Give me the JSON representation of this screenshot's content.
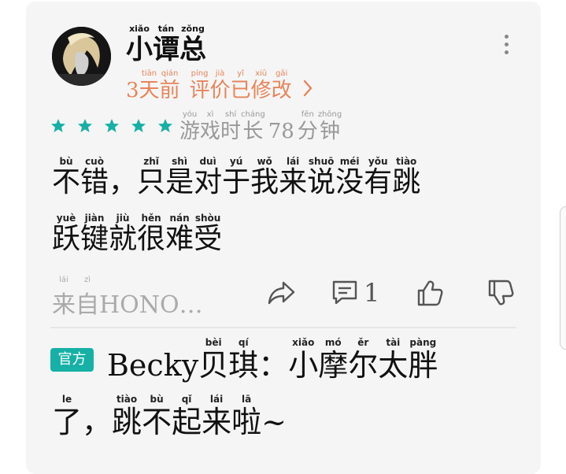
{
  "review": {
    "user_name": [
      [
        "xiǎo",
        "小"
      ],
      [
        "tán",
        "谭"
      ],
      [
        "zǒng",
        "总"
      ]
    ],
    "meta": [
      [
        "3",
        ""
      ],
      [
        "tiān",
        "天"
      ],
      [
        "qián",
        "前"
      ],
      [
        "",
        ""
      ],
      [
        "píng",
        "评"
      ],
      [
        "jià",
        "价"
      ],
      [
        "yǐ",
        "已"
      ],
      [
        "xiū",
        "修"
      ],
      [
        "gǎi",
        "改"
      ]
    ],
    "meta_text": "3天前 评价已修改",
    "rating_stars": 5,
    "playtime_label": [
      [
        "yóu",
        "游"
      ],
      [
        "xì",
        "戏"
      ],
      [
        "shí",
        "时"
      ],
      [
        "cháng",
        "长"
      ]
    ],
    "playtime_value": "78",
    "playtime_unit": [
      [
        "fēn",
        "分"
      ],
      [
        "zhōng",
        "钟"
      ]
    ],
    "body_line1": [
      [
        "bù",
        "不"
      ],
      [
        "cuò",
        "错"
      ],
      [
        "",
        "，"
      ],
      [
        "zhǐ",
        "只"
      ],
      [
        "shì",
        "是"
      ],
      [
        "duì",
        "对"
      ],
      [
        "yú",
        "于"
      ],
      [
        "wǒ",
        "我"
      ],
      [
        "lái",
        "来"
      ],
      [
        "shuō",
        "说"
      ],
      [
        "méi",
        "没"
      ],
      [
        "yǒu",
        "有"
      ],
      [
        "tiào",
        "跳"
      ]
    ],
    "body_line2": [
      [
        "yuè",
        "跃"
      ],
      [
        "jiàn",
        "键"
      ],
      [
        "jiù",
        "就"
      ],
      [
        "hěn",
        "很"
      ],
      [
        "nán",
        "难"
      ],
      [
        "shòu",
        "受"
      ]
    ],
    "source_prefix": [
      [
        "lái",
        "来"
      ],
      [
        "zì",
        "自"
      ]
    ],
    "source_device": "HONO…",
    "comment_count": "1"
  },
  "reply": {
    "badge": "官方",
    "author": "Becky",
    "author_cn": [
      [
        "bèi",
        "贝"
      ],
      [
        "qí",
        "琪"
      ],
      [
        "",
        "："
      ]
    ],
    "line1": [
      [
        "xiǎo",
        "小"
      ],
      [
        "mó",
        "摩"
      ],
      [
        "ěr",
        "尔"
      ],
      [
        "tài",
        "太"
      ],
      [
        "pàng",
        "胖"
      ]
    ],
    "line2": [
      [
        "le",
        "了"
      ],
      [
        "",
        "，"
      ],
      [
        "tiào",
        "跳"
      ],
      [
        "bù",
        "不"
      ],
      [
        "qǐ",
        "起"
      ],
      [
        "lái",
        "来"
      ],
      [
        "lā",
        "啦"
      ]
    ],
    "line2_tail": "~"
  },
  "colors": {
    "accent_orange": "#e8845a",
    "star_teal": "#17b0a6",
    "badge_teal": "#17b0a6",
    "muted_gray": "#999999"
  },
  "icons": [
    "more-vertical-icon",
    "star-icon",
    "share-icon",
    "comment-icon",
    "thumbs-up-icon",
    "thumbs-down-icon",
    "chevron-right-icon"
  ]
}
